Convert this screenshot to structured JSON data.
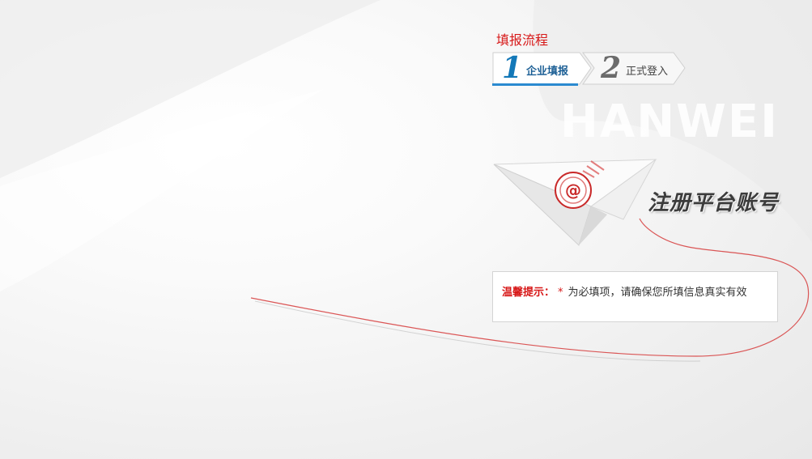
{
  "brand": {
    "watermark": "HANWEI"
  },
  "flow": {
    "title": "填报流程",
    "steps": [
      {
        "number": "1",
        "label": "企业填报",
        "state": "active"
      },
      {
        "number": "2",
        "label": "正式登入",
        "state": "inactive"
      }
    ]
  },
  "hero": {
    "slogan": "注册平台账号",
    "icon": "paper-plane-email-icon"
  },
  "tip": {
    "label": "温馨提示：",
    "required_mark": "*",
    "text": "为必填项，请确保您所填信息真实有效"
  },
  "colors": {
    "accent_red": "#d71818",
    "step_blue": "#1378b8",
    "underline_blue": "#2b8ad0"
  }
}
